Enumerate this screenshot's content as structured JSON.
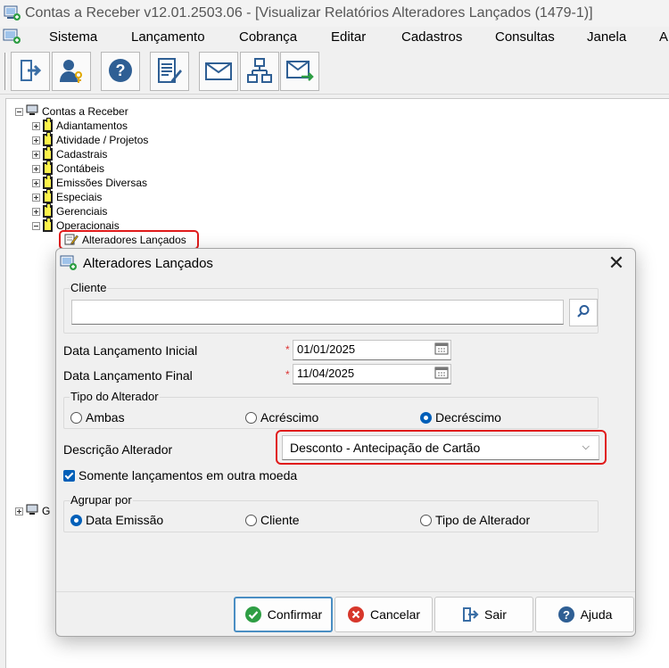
{
  "window": {
    "title": "Contas a Receber v12.01.2503.06 - [Visualizar Relatórios Alteradores  Lançados (1479-1)]"
  },
  "menu": [
    "Sistema",
    "Lançamento",
    "Cobrança",
    "Editar",
    "Cadastros",
    "Consultas",
    "Janela",
    "A"
  ],
  "toolbar": {
    "buttons": [
      "exit-icon",
      "user-key-icon",
      "help-icon",
      "edit-report-icon",
      "envelope-icon",
      "network-icon",
      "send-mail-icon"
    ]
  },
  "tree": {
    "root": "Contas a Receber",
    "items": [
      "Adiantamentos",
      "Atividade / Projetos",
      "Cadastrais",
      "Contábeis",
      "Emissões Diversas",
      "Especiais",
      "Gerenciais",
      "Operacionais"
    ],
    "selected": "Alteradores  Lançados",
    "second_root": "G"
  },
  "dialog": {
    "title": "Alteradores Lançados",
    "close": "✕",
    "cliente_label": "Cliente",
    "cliente_value": "",
    "data_inicial_label": "Data Lançamento Inicial",
    "data_inicial_value": "01/01/2025",
    "data_final_label": "Data Lançamento Final",
    "data_final_value": "11/04/2025",
    "required_mark": "*",
    "tipo_label": "Tipo do Alterador",
    "tipo_options": [
      "Ambas",
      "Acréscimo",
      "Decréscimo"
    ],
    "tipo_selected": "Decréscimo",
    "descricao_label": "Descrição Alterador",
    "descricao_value": "Desconto - Antecipação de Cartão",
    "chevron": "⌵",
    "somente_label": "Somente lançamentos em outra moeda",
    "somente_checked": true,
    "agrupar_label": "Agrupar por",
    "agrupar_options": [
      "Data Emissão",
      "Cliente",
      "Tipo de Alterador"
    ],
    "agrupar_selected": "Data Emissão",
    "buttons": [
      "Confirmar",
      "Cancelar",
      "Sair",
      "Ajuda"
    ]
  }
}
